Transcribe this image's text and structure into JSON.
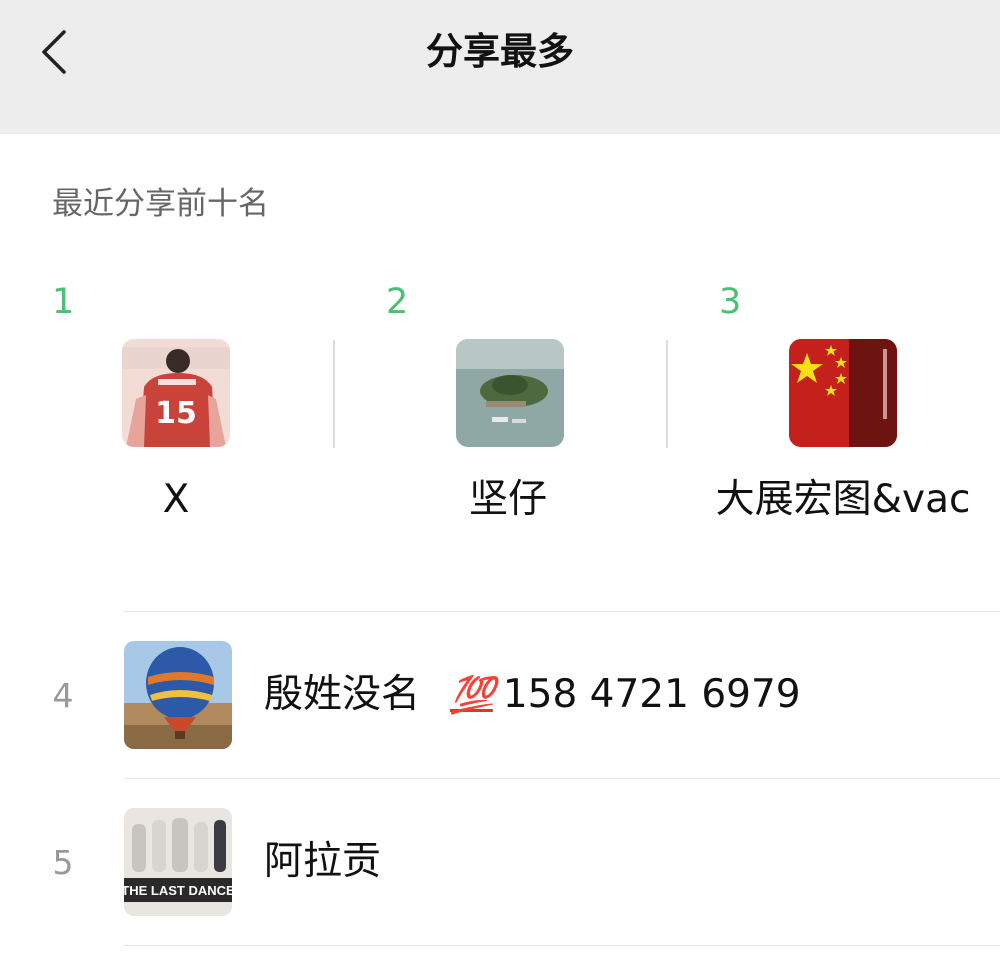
{
  "header": {
    "title": "分享最多",
    "back_icon": "chevron-left-icon"
  },
  "section": {
    "label": "最近分享前十名"
  },
  "colors": {
    "rank_top": "#4bbf73",
    "rank_other": "#999999",
    "header_bg": "#ededed",
    "divider": "#e6e6e6"
  },
  "top_three": [
    {
      "rank": "1",
      "name": "X",
      "avatar": "football-player-number-15-avatar"
    },
    {
      "rank": "2",
      "name": "坚仔",
      "avatar": "island-aerial-photo-avatar"
    },
    {
      "rank": "3",
      "name": "大展宏图&vac",
      "avatar": "chinese-flag-avatar"
    }
  ],
  "list": [
    {
      "rank": "4",
      "name": "殷姓没名",
      "emoji": "💯",
      "emoji_name": "hundred-points-icon",
      "phone": "158 4721 6979",
      "avatar": "hot-air-balloon-avatar"
    },
    {
      "rank": "5",
      "name": "阿拉贡",
      "avatar": "the-last-dance-poster-avatar",
      "poster_text": "THE LAST DANCE"
    }
  ]
}
